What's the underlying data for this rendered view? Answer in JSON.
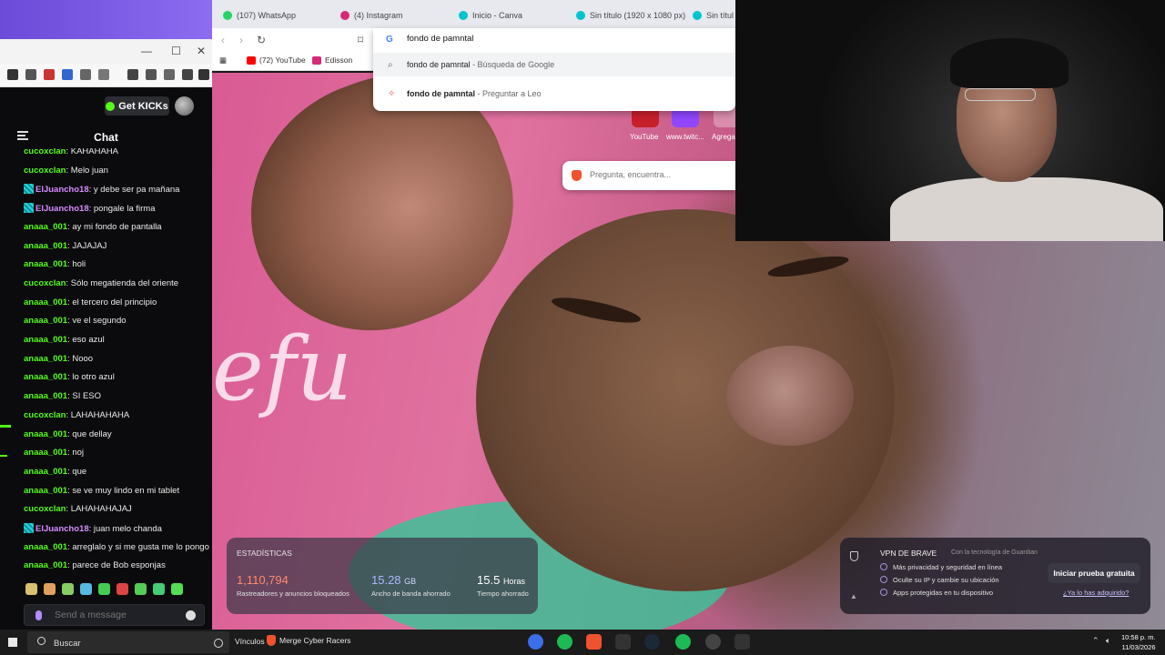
{
  "browser": {
    "tabs": [
      {
        "label": "(107) WhatsApp",
        "icon": "whatsapp-icon",
        "color": "#25d366"
      },
      {
        "label": "(4) Instagram",
        "icon": "instagram-icon",
        "color": "#d62976"
      },
      {
        "label": "Inicio - Canva",
        "icon": "canva-icon",
        "color": "#00c4cc"
      },
      {
        "label": "Sin título (1920 x 1080 px)",
        "icon": "canva-icon",
        "color": "#00c4cc"
      },
      {
        "label": "Sin título",
        "icon": "canva-icon",
        "color": "#00c4cc"
      }
    ],
    "bookmarks": [
      {
        "label": "(72) YouTube",
        "icon": "youtube-icon",
        "color": "#ff0000"
      },
      {
        "label": "Edisson",
        "icon": "instagram-icon",
        "color": "#d62976"
      }
    ],
    "omnibox": {
      "value": "fondo de pamntal",
      "suggestions": [
        {
          "text": "fondo de pamntal",
          "sub": " - Búsqueda de Google",
          "icon": "search-icon"
        },
        {
          "text": "fondo de pamntal",
          "sub": " - Preguntar a Leo",
          "icon": "leo-icon"
        }
      ]
    },
    "speed_dial": [
      {
        "label": "YouTube"
      },
      {
        "label": "www.twitc..."
      },
      {
        "label": "Agrega"
      }
    ],
    "leo_placeholder": "Pregunta, encuentra...",
    "background_text": "efu",
    "stats": {
      "title": "ESTADÍSTICAS",
      "items": [
        {
          "value": "1,110,794",
          "unit": "",
          "label": "Rastreadores y anuncios bloqueados",
          "color": "#ff8a6b"
        },
        {
          "value": "15.28",
          "unit": "GB",
          "label": "Ancho de banda ahorrado",
          "color": "#a7b7ff"
        },
        {
          "value": "15.5",
          "unit": "Horas",
          "label": "Tiempo ahorrado",
          "color": "#ffffff"
        }
      ]
    },
    "vpn": {
      "title": "VPN DE BRAVE",
      "subtitle": "Con la tecnología de Guardian",
      "features": [
        "Más privacidad y seguridad en línea",
        "Oculte su IP y cambie su ubicación",
        "Apps protegidas en tu dispositivo"
      ],
      "cta": "Iniciar prueba gratuita",
      "link": "¿Ya lo has adquirido?"
    }
  },
  "chat": {
    "get_kicks": "Get KICKs",
    "title": "Chat",
    "send_placeholder": "Send a message",
    "messages": [
      {
        "user": "cucoxclan",
        "color": "#53fc18",
        "text": ": KAHAHAHA",
        "badge": false
      },
      {
        "user": "cucoxclan",
        "color": "#53fc18",
        "text": ": Melo juan",
        "badge": false
      },
      {
        "user": "ElJuancho18",
        "color": "#d68bff",
        "text": ": y debe ser pa mañana",
        "badge": true
      },
      {
        "user": "ElJuancho18",
        "color": "#d68bff",
        "text": ": pongale la firma",
        "badge": true
      },
      {
        "user": "anaaa_001",
        "color": "#53fc18",
        "text": ": ay mi fondo de pantalla",
        "badge": false
      },
      {
        "user": "anaaa_001",
        "color": "#53fc18",
        "text": ": JAJAJAJ",
        "badge": false
      },
      {
        "user": "anaaa_001",
        "color": "#53fc18",
        "text": ": holi",
        "badge": false
      },
      {
        "user": "cucoxclan",
        "color": "#53fc18",
        "text": ": Sólo megatienda del oriente",
        "badge": false
      },
      {
        "user": "anaaa_001",
        "color": "#53fc18",
        "text": ": el tercero del principio",
        "badge": false
      },
      {
        "user": "anaaa_001",
        "color": "#53fc18",
        "text": ": ve el segundo",
        "badge": false
      },
      {
        "user": "anaaa_001",
        "color": "#53fc18",
        "text": ": eso azul",
        "badge": false
      },
      {
        "user": "anaaa_001",
        "color": "#53fc18",
        "text": ": Nooo",
        "badge": false
      },
      {
        "user": "anaaa_001",
        "color": "#53fc18",
        "text": ": lo otro azul",
        "badge": false
      },
      {
        "user": "anaaa_001",
        "color": "#53fc18",
        "text": ": SI ESO",
        "badge": false
      },
      {
        "user": "cucoxclan",
        "color": "#53fc18",
        "text": ": LAHAHAHAHA",
        "badge": false
      },
      {
        "user": "anaaa_001",
        "color": "#53fc18",
        "text": ": que dellay",
        "badge": false
      },
      {
        "user": "anaaa_001",
        "color": "#53fc18",
        "text": ": noj",
        "badge": false
      },
      {
        "user": "anaaa_001",
        "color": "#53fc18",
        "text": ": que",
        "badge": false
      },
      {
        "user": "anaaa_001",
        "color": "#53fc18",
        "text": ": se ve muy lindo en mi tablet",
        "badge": false
      },
      {
        "user": "cucoxclan",
        "color": "#53fc18",
        "text": ": LAHAHAHAJAJ",
        "badge": false
      },
      {
        "user": "ElJuancho18",
        "color": "#d68bff",
        "text": ": juan melo chanda",
        "badge": true
      },
      {
        "user": "anaaa_001",
        "color": "#53fc18",
        "text": ": arreglalo y si me gusta me lo pongo",
        "badge": false
      },
      {
        "user": "anaaa_001",
        "color": "#53fc18",
        "text": ": parece de Bob esponjas",
        "badge": false
      }
    ],
    "emote_colors": [
      "#d9c070",
      "#e0a060",
      "#88cc66",
      "#55b9e0",
      "#44cc55",
      "#dd4444",
      "#55cc55",
      "#44cc77",
      "#55dd55"
    ]
  },
  "taskbar": {
    "search_placeholder": "Buscar",
    "vinculos": "Vínculos",
    "running_app": "Merge Cyber Racers",
    "time": "10:58 p. m.",
    "date": "11/03/2026"
  }
}
